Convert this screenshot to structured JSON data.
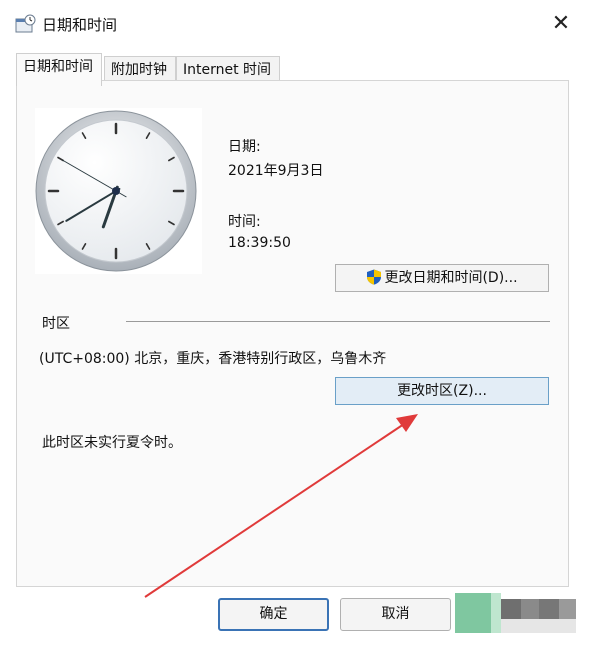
{
  "window": {
    "title": "日期和时间",
    "close_glyph": "✕"
  },
  "tabs": [
    {
      "label": "日期和时间",
      "active": true
    },
    {
      "label": "附加时钟",
      "active": false
    },
    {
      "label": "Internet 时间",
      "active": false
    }
  ],
  "date_section": {
    "date_label": "日期:",
    "date_value": "2021年9月3日",
    "time_label": "时间:",
    "time_value": "18:39:50"
  },
  "change_datetime_button": {
    "label": "更改日期和时间(D)..."
  },
  "timezone": {
    "heading": "时区",
    "value": "(UTC+08:00) 北京，重庆，香港特别行政区，乌鲁木齐",
    "change_button": "更改时区(Z)...",
    "dst_note": "此时区未实行夏令时。"
  },
  "footer": {
    "ok": "确定",
    "cancel": "取消"
  },
  "clock": {
    "hour": 18,
    "minute": 39,
    "second": 50
  },
  "colors": {
    "annotation_arrow": "#e03a3a",
    "focus_button_border": "#3a73b5",
    "highlight_button_bg": "#e3edf6"
  }
}
